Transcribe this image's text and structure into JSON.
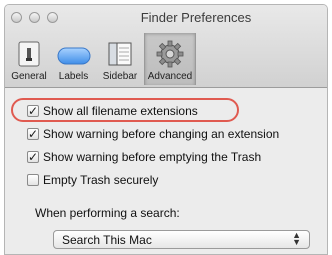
{
  "window": {
    "title": "Finder Preferences"
  },
  "toolbar": {
    "tabs": [
      {
        "label": "General",
        "icon": "general-icon"
      },
      {
        "label": "Labels",
        "icon": "labels-icon"
      },
      {
        "label": "Sidebar",
        "icon": "sidebar-icon"
      },
      {
        "label": "Advanced",
        "icon": "gear-icon",
        "active": true
      }
    ]
  },
  "options": [
    {
      "label": "Show all filename extensions",
      "checked": true,
      "check_glyph": "✓"
    },
    {
      "label": "Show warning before changing an extension",
      "checked": true,
      "check_glyph": "✓"
    },
    {
      "label": "Show warning before emptying the Trash",
      "checked": true,
      "check_glyph": "✓"
    },
    {
      "label": "Empty Trash securely",
      "checked": false,
      "check_glyph": ""
    }
  ],
  "search": {
    "label": "When performing a search:",
    "selected": "Search This Mac"
  },
  "annotation_color": "#e05a50"
}
